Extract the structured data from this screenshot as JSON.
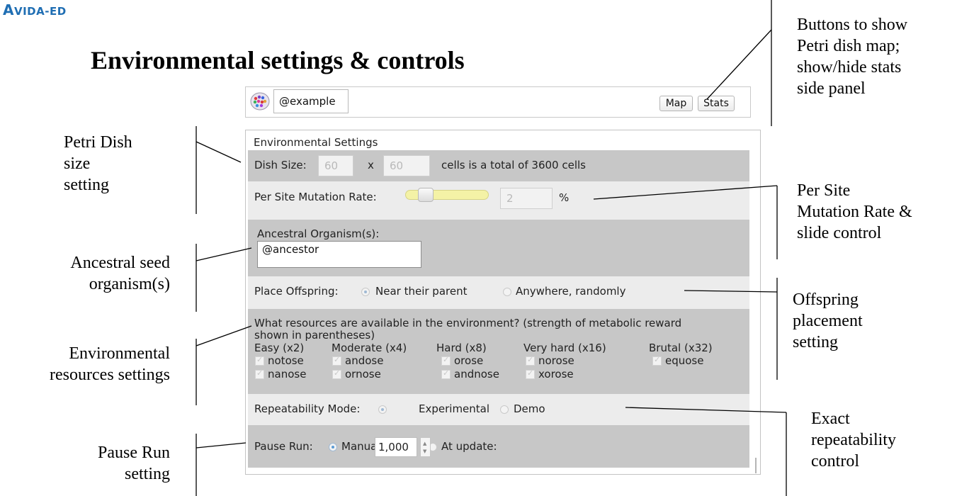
{
  "logo": {
    "text_a": "A",
    "text_b": "VIDA",
    "text_c": "-ED"
  },
  "page_title": "Environmental settings & controls",
  "topbar": {
    "organism_icon": "petri-dish-icon",
    "name_value": "@example",
    "map_label": "Map",
    "stats_label": "Stats"
  },
  "settings": {
    "header": "Environmental Settings",
    "dish_size": {
      "label": "Dish Size:",
      "cols": "60",
      "x": "x",
      "rows": "60",
      "suffix": "cells is a total of 3600 cells"
    },
    "mutation": {
      "label": "Per Site Mutation Rate:",
      "value": "2",
      "unit": "%",
      "slider_fraction": 0.2
    },
    "ancestor": {
      "label": "Ancestral Organism(s):",
      "value": "@ancestor"
    },
    "offspring": {
      "label": "Place Offspring:",
      "opt_near": "Near their parent",
      "opt_anywhere": "Anywhere, randomly",
      "selected": "Near their parent"
    },
    "resources": {
      "question_line1": "What resources are available in the environment? (strength of metabolic reward",
      "question_line2": "shown in parentheses)",
      "groups": [
        {
          "heading": "Easy (x2)",
          "items": [
            "notose",
            "nanose"
          ]
        },
        {
          "heading": "Moderate (x4)",
          "items": [
            "andose",
            "ornose"
          ]
        },
        {
          "heading": "Hard (x8)",
          "items": [
            "orose",
            "andnose"
          ]
        },
        {
          "heading": "Very hard (x16)",
          "items": [
            "norose",
            "xorose"
          ]
        },
        {
          "heading": "Brutal (x32)",
          "items": [
            "equose"
          ]
        }
      ]
    },
    "repeatability": {
      "label": "Repeatability Mode:",
      "opt_experimental": "Experimental",
      "opt_demo": "Demo",
      "selected": "Experimental"
    },
    "pause": {
      "label": "Pause Run:",
      "opt_manual": "Manually",
      "opt_update": "At update:",
      "update_value": "1,000",
      "selected": "Manually"
    }
  },
  "annotations": {
    "buttons": [
      "Buttons to show",
      "Petri dish map;",
      "show/hide stats",
      "side panel"
    ],
    "dish": [
      "Petri Dish",
      "size",
      "setting"
    ],
    "mutation": [
      "Per Site",
      "Mutation Rate &",
      "slide control"
    ],
    "ancestor": [
      "Ancestral seed",
      "organism(s)"
    ],
    "offspring": [
      "Offspring",
      "placement",
      "setting"
    ],
    "resources": [
      "Environmental",
      "resources settings"
    ],
    "repeat": [
      "Exact",
      "repeatability",
      "control"
    ],
    "pause": [
      "Pause Run",
      "setting"
    ]
  }
}
